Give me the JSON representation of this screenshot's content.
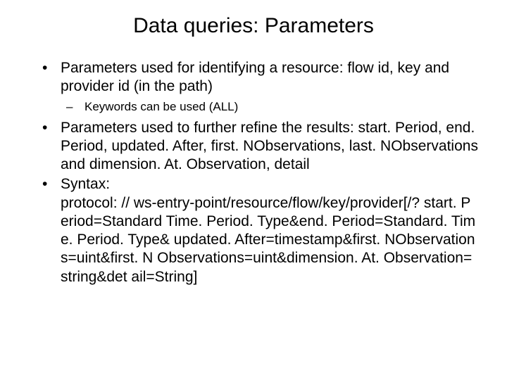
{
  "title": "Data queries: Parameters",
  "bullets": [
    {
      "text": "Parameters used for identifying a resource: flow id, key and provider id (in the path)",
      "sub": [
        {
          "text": "Keywords can be used (ALL)"
        }
      ]
    },
    {
      "text": "Parameters used to further refine the results: start. Period, end. Period, updated. After, first. NObservations, last. NObservations and dimension. At. Observation, detail"
    },
    {
      "text": "Syntax:",
      "syntax": "protocol: // ws-entry-point/resource/flow/key/provider[/? start. Period=Standard Time. Period. Type&end. Period=Standard. Time. Period. Type& updated. After=timestamp&first. NObservations=uint&first. N Observations=uint&dimension. At. Observation=string&det ail=String]"
    }
  ]
}
